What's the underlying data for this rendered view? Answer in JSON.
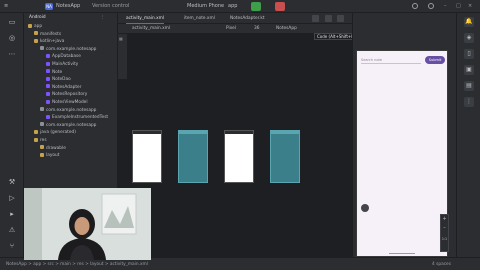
{
  "titlebar": {
    "project_badge": "NA",
    "project_name": "NotesApp",
    "branch": "Version control",
    "device": "Medium Phone",
    "run_config": "app"
  },
  "project": {
    "view_mode": "Android",
    "tree": [
      {
        "label": "app",
        "indent": 0,
        "kind": "folder"
      },
      {
        "label": "manifests",
        "indent": 1,
        "kind": "folder"
      },
      {
        "label": "kotlin+java",
        "indent": 1,
        "kind": "folder"
      },
      {
        "label": "com.example.notesapp",
        "indent": 2,
        "kind": "package"
      },
      {
        "label": "AppDatabase",
        "indent": 3,
        "kind": "kotlin"
      },
      {
        "label": "MainActivity",
        "indent": 3,
        "kind": "kotlin"
      },
      {
        "label": "Note",
        "indent": 3,
        "kind": "kotlin"
      },
      {
        "label": "NoteDao",
        "indent": 3,
        "kind": "kotlin"
      },
      {
        "label": "NotesAdapter",
        "indent": 3,
        "kind": "kotlin"
      },
      {
        "label": "NotesRepository",
        "indent": 3,
        "kind": "kotlin"
      },
      {
        "label": "NotesViewModel",
        "indent": 3,
        "kind": "kotlin"
      },
      {
        "label": "com.example.notesapp",
        "indent": 2,
        "kind": "package"
      },
      {
        "label": "ExampleInstrumentedTest",
        "indent": 3,
        "kind": "kotlin"
      },
      {
        "label": "com.example.notesapp",
        "indent": 2,
        "kind": "package"
      },
      {
        "label": "java (generated)",
        "indent": 1,
        "kind": "folder"
      },
      {
        "label": "res",
        "indent": 1,
        "kind": "folder"
      },
      {
        "label": "drawable",
        "indent": 2,
        "kind": "folder"
      },
      {
        "label": "layout",
        "indent": 2,
        "kind": "folder"
      }
    ]
  },
  "tabs": [
    {
      "label": "activity_main.xml",
      "active": true
    },
    {
      "label": "item_note.xml",
      "active": false
    },
    {
      "label": "NotesAdapter.kt",
      "active": false
    }
  ],
  "tooltip": "Code (Alt+Shift+Right)",
  "design": {
    "file": "activity_main.xml",
    "theme": "Pixel",
    "api": "36",
    "app_theme": "NotesApp"
  },
  "device_panel": {
    "title": "Medium Phone AP...",
    "search_placeholder": "Search note",
    "submit_label": "Submit",
    "zoom_label": "1:1"
  },
  "statusbar": {
    "breadcrumb": "NotesApp > app > src > main > res > layout > activity_main.xml",
    "position": "4 spaces"
  }
}
